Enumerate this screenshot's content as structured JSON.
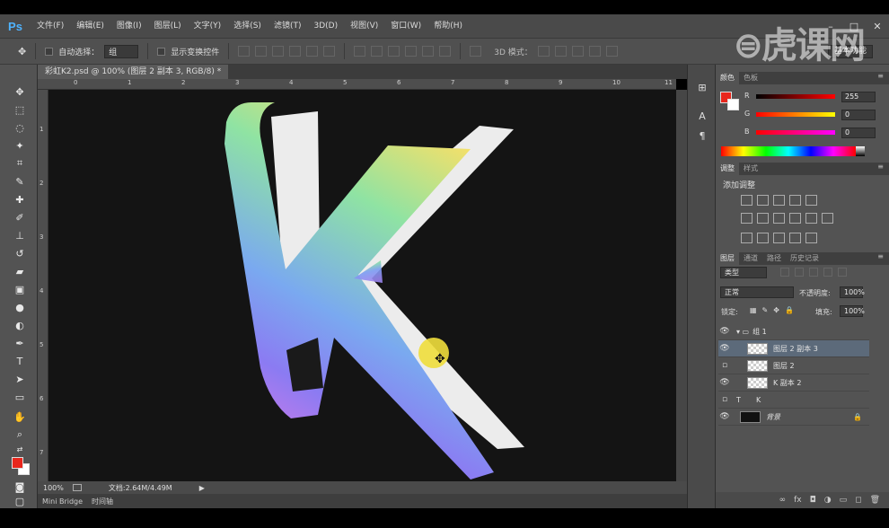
{
  "app": {
    "logo": "Ps",
    "menu": [
      "文件(F)",
      "编辑(E)",
      "图像(I)",
      "图层(L)",
      "文字(Y)",
      "选择(S)",
      "滤镜(T)",
      "3D(D)",
      "视图(V)",
      "窗口(W)",
      "帮助(H)"
    ],
    "window_controls": [
      "–",
      "□",
      "✕"
    ],
    "watermark": "虎课网"
  },
  "options": {
    "auto_select_label": "自动选择：",
    "auto_select_value": "组",
    "show_transform_label": "显示变换控件",
    "mode_label": "3D 模式：",
    "workspace": "基本功能"
  },
  "document": {
    "tab_title": "彩虹K2.psd @ 100% (图层 2 副本 3, RGB/8) *",
    "ruler_marks": [
      "0",
      "1",
      "2",
      "3",
      "4",
      "5",
      "6",
      "7",
      "8",
      "9",
      "10",
      "11"
    ],
    "vruler_marks": [
      "1",
      "2",
      "3",
      "4",
      "5",
      "6",
      "7"
    ],
    "zoom": "100%",
    "doc_size": "文档:2.64M/4.49M",
    "bottom_tabs": [
      "Mini Bridge",
      "时间轴"
    ]
  },
  "color_panel": {
    "tabs": [
      "颜色",
      "色板"
    ],
    "r_label": "R",
    "r_value": "255",
    "g_label": "G",
    "g_value": "0",
    "b_label": "B",
    "b_value": "0",
    "fg_color": "#e8261c"
  },
  "adjust_panel": {
    "tabs": [
      "调整",
      "样式"
    ],
    "title": "添加调整"
  },
  "layers_panel": {
    "tabs": [
      "图层",
      "通道",
      "路径",
      "历史记录"
    ],
    "filter": "类型",
    "blend_mode": "正常",
    "opacity_label": "不透明度:",
    "opacity_value": "100%",
    "lock_label": "锁定:",
    "fill_label": "填充:",
    "fill_value": "100%",
    "layers": [
      {
        "name": "组 1"
      },
      {
        "name": "图层 2 副本 3"
      },
      {
        "name": "图层 2"
      },
      {
        "name": "K 副本 2"
      },
      {
        "name": "K"
      },
      {
        "name": "背景"
      }
    ]
  }
}
